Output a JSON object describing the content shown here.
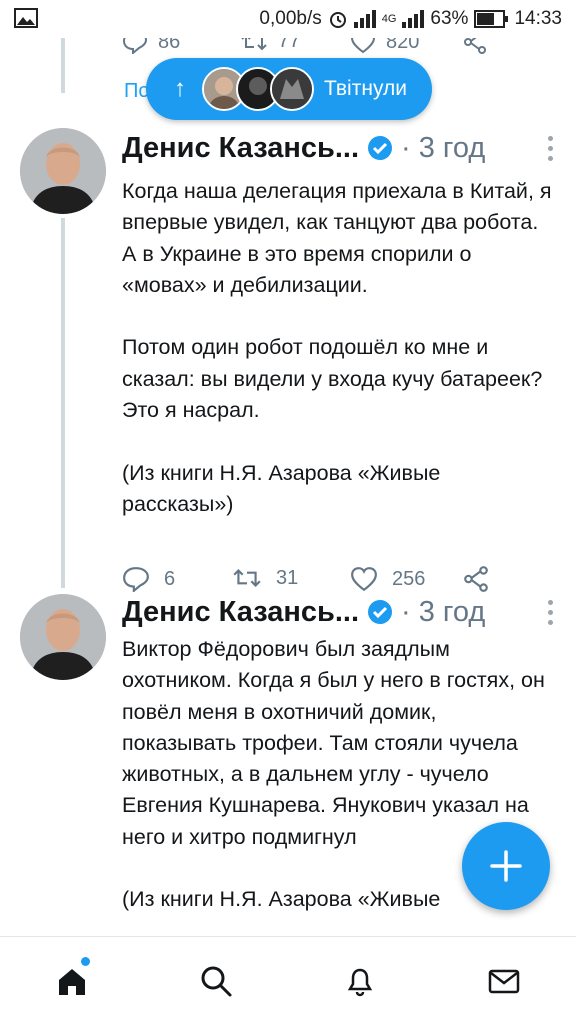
{
  "status_bar": {
    "network_speed": "0,00b/s",
    "network_type": "4G",
    "battery": "63%",
    "time": "14:33",
    "icons": [
      "image-icon",
      "alarm-icon",
      "signal-icon",
      "battery-icon"
    ]
  },
  "previous_tweet": {
    "replies": "86",
    "retweets": "77",
    "likes": "820",
    "show_more_label": "По"
  },
  "new_tweets_pill": {
    "label": "Твітнули",
    "icon": "arrow-up-icon"
  },
  "tweets": [
    {
      "name": "Денис Казансь...",
      "time": "· 3 год",
      "text": "Когда наша делегация приехала в Китай, я впервые увидел, как танцуют два робота. А в Украине в это время спорили о «мовах» и дебилизации.\n\nПотом один робот подошёл ко мне и сказал: вы видели у входа кучу батареек? Это я насрал.\n\n(Из книги Н.Я. Азарова «Живые рассказы»)",
      "replies": "6",
      "retweets": "31",
      "likes": "256"
    },
    {
      "name": "Денис Казансь...",
      "time": "· 3 год",
      "text": "Виктор Фёдорович был заядлым охотником. Когда я был у него в гостях, он повёл меня в охотничий домик, показывать трофеи. Там стояли чучела животных, а в дальнем углу - чучело Евгения Кушнарева. Янукович указал на него и хитро подмигнул\n\n(Из книги Н.Я. Азарова «Живые"
    }
  ],
  "fab_icon": "plus-icon",
  "bottom_nav": [
    "home-icon",
    "search-icon",
    "notifications-icon",
    "messages-icon"
  ],
  "colors": {
    "accent": "#1d9bf0",
    "muted": "#657786"
  }
}
